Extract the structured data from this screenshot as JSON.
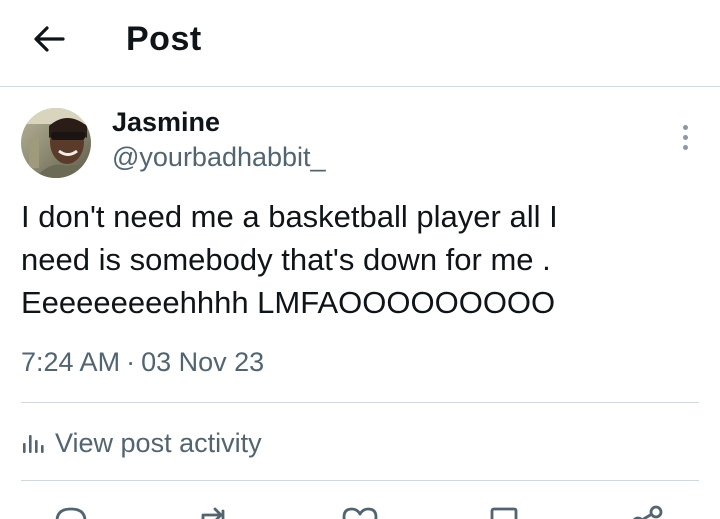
{
  "header": {
    "back_icon": "arrow-left-icon",
    "title": "Post"
  },
  "post": {
    "author": {
      "display_name": "Jasmine",
      "handle": "@yourbadhabbit_",
      "avatar_icon": "avatar-photo"
    },
    "more_icon": "more-vertical-icon",
    "text_lines": [
      "I don't need me a basketball player all I",
      "need is somebody that's down for me .",
      "Eeeeeeeeehhhh LMFAOOOOOOOOO"
    ],
    "time": "7:24 AM",
    "separator": "·",
    "date": "03 Nov 23"
  },
  "activity": {
    "icon": "analytics-icon",
    "label": "View post activity"
  },
  "actions": {
    "reply_icon": "reply-icon",
    "repost_icon": "repost-icon",
    "like_icon": "heart-icon",
    "bookmark_icon": "bookmark-icon",
    "share_icon": "share-icon"
  },
  "colors": {
    "text_primary": "#0f1419",
    "text_secondary": "#536471",
    "divider": "#cfd9de",
    "background": "#ffffff"
  }
}
